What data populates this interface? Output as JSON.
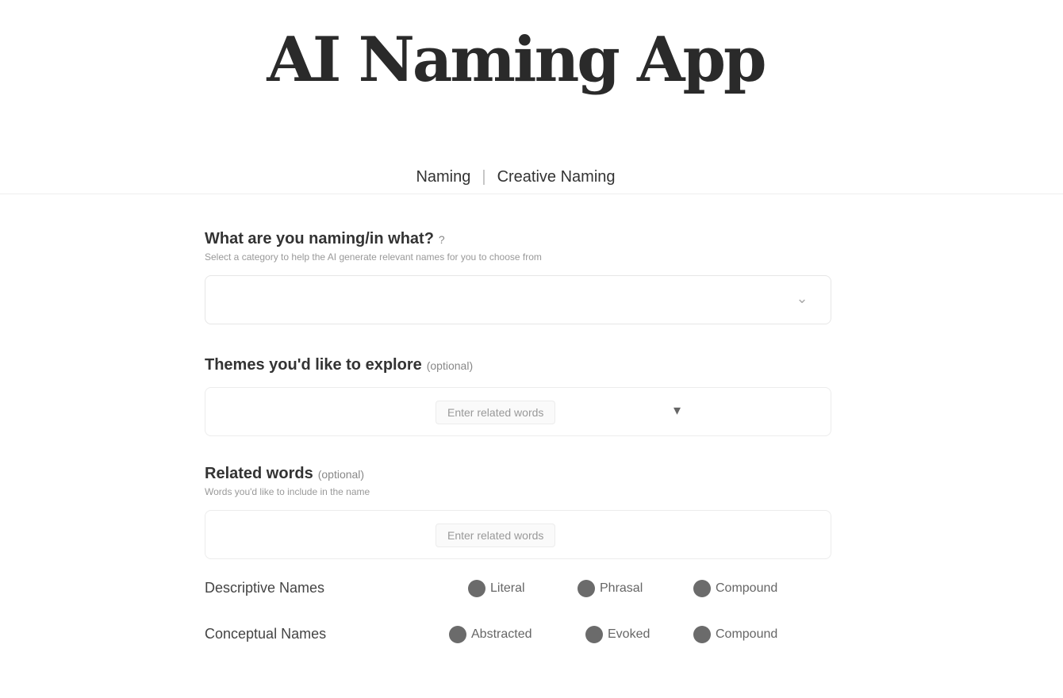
{
  "app": {
    "title": "AI Naming App"
  },
  "nav": {
    "tabs": [
      {
        "label": "Naming"
      },
      {
        "label": "Creative Naming"
      }
    ]
  },
  "form": {
    "category": {
      "label": "What are you naming/in what?",
      "hint": "?",
      "sub": "Select a category to help the AI generate relevant names for you to choose from"
    },
    "keywords": {
      "label": "Themes you'd like to explore",
      "hint": "(optional)",
      "placeholder": "Enter related words"
    },
    "related": {
      "label": "Related words",
      "hint": "(optional)",
      "sub": "Words you'd like to include in the name",
      "placeholder": "Enter related words"
    },
    "descriptive": {
      "label": "Descriptive Names",
      "options": [
        "Literal",
        "Phrasal",
        "Compound"
      ]
    },
    "conceptual": {
      "label": "Conceptual Names",
      "options": [
        "Abstracted",
        "Evoked",
        "Compound"
      ]
    }
  }
}
